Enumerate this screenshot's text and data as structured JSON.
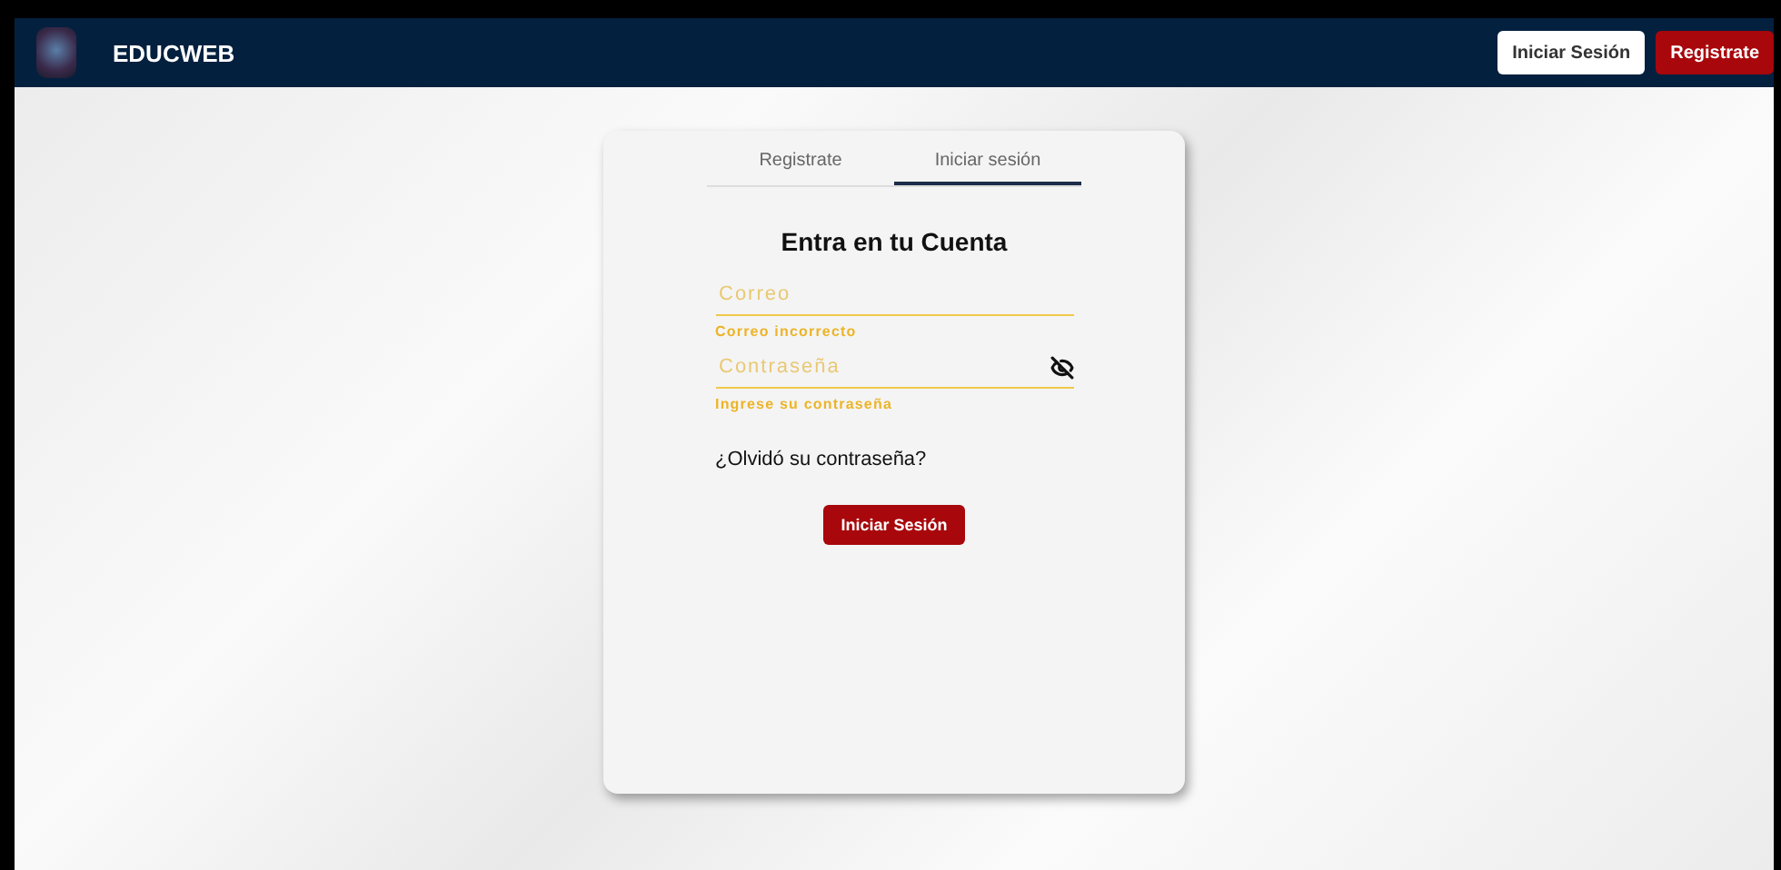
{
  "navbar": {
    "brand": "EDUCWEB",
    "buttons": [
      {
        "label": "Iniciar Sesión",
        "kind": "outline"
      },
      {
        "label": "Registrate",
        "kind": "filled"
      }
    ]
  },
  "tabs": [
    {
      "label": "Registrate",
      "selected": false
    },
    {
      "label": "Iniciar sesión",
      "selected": true
    }
  ],
  "form": {
    "title": "Entra en tu Cuenta",
    "fields": [
      {
        "placeholder": "Correo",
        "error": "Correo incorrecto",
        "kind": "text"
      },
      {
        "placeholder": "Contraseña",
        "error": "Ingrese su contraseña",
        "kind": "password"
      }
    ],
    "forgot": "¿Olvidó su contraseña?",
    "submit": "Iniciar Sesión"
  }
}
